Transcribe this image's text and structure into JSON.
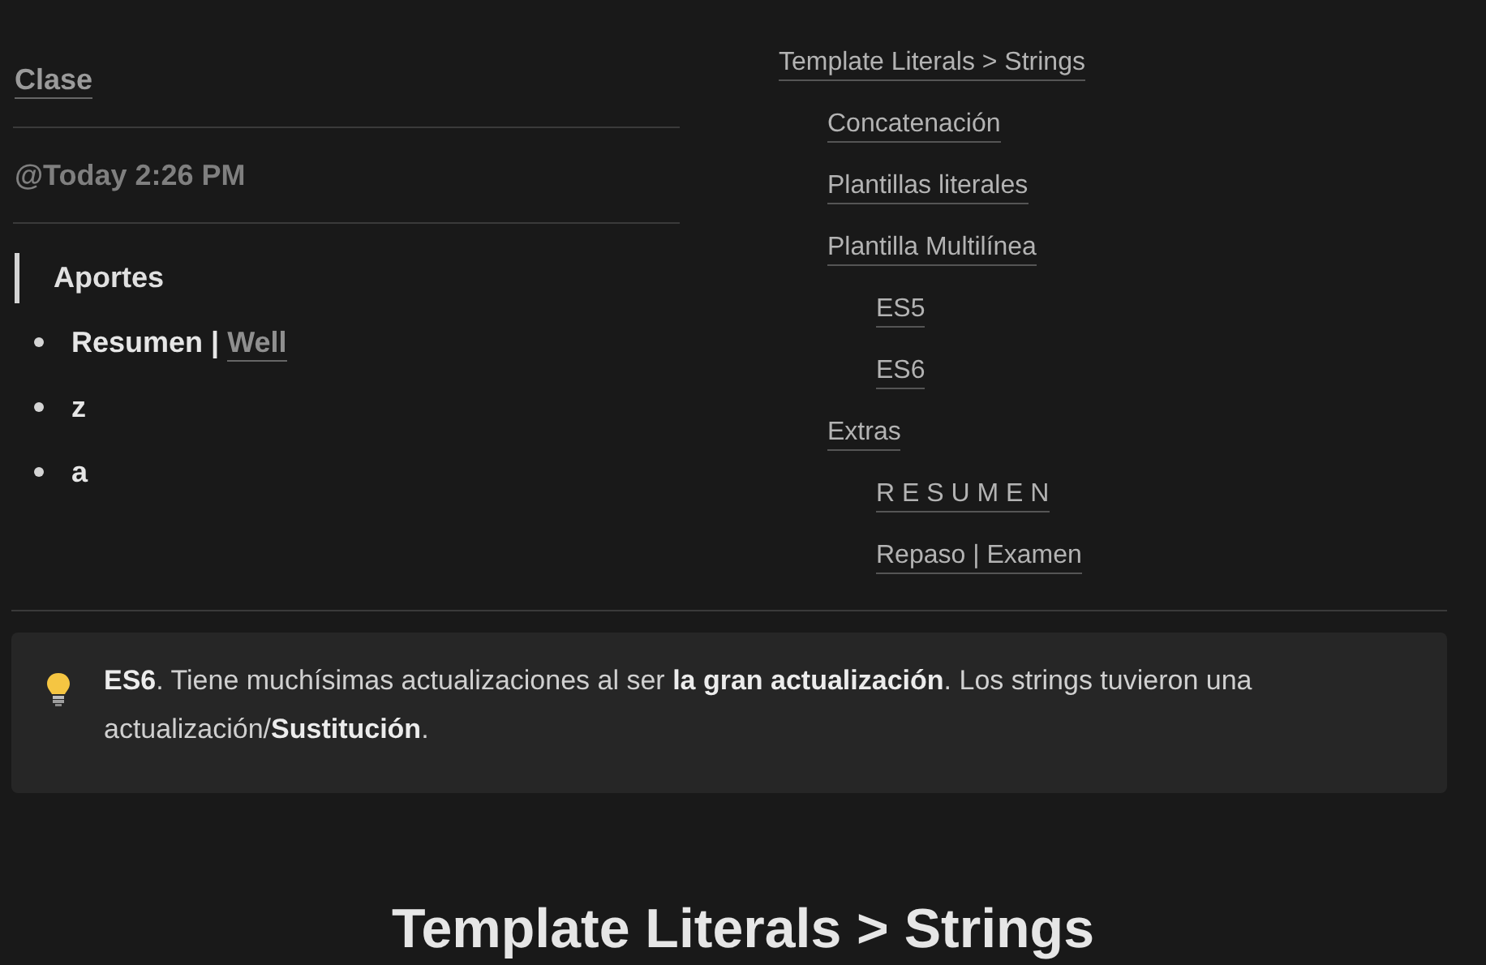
{
  "properties": [
    {
      "kind": "link",
      "text": "Clase"
    },
    {
      "kind": "date",
      "text": "@Today 2:26 PM"
    }
  ],
  "quote": "Aportes",
  "bullets": [
    {
      "text": "Resumen |",
      "link": "Well"
    },
    {
      "text": "z"
    },
    {
      "text": "a"
    }
  ],
  "toc": [
    {
      "label": "Template Literals > Strings",
      "children": [
        {
          "label": "Concatenación"
        },
        {
          "label": "Plantillas literales"
        },
        {
          "label": "Plantilla Multilínea",
          "children": [
            {
              "label": "ES5"
            },
            {
              "label": "ES6"
            }
          ]
        },
        {
          "label": "Extras",
          "children": [
            {
              "label": "R E S U M E N"
            },
            {
              "label": "Repaso | Examen"
            }
          ]
        }
      ]
    }
  ],
  "callout": {
    "text": "**ES6**. Tiene muchísimas actualizaciones al ser **la gran actualización**. Los strings tuvieron una actualización/**Sustitución**."
  },
  "heading": "Template Literals > Strings"
}
